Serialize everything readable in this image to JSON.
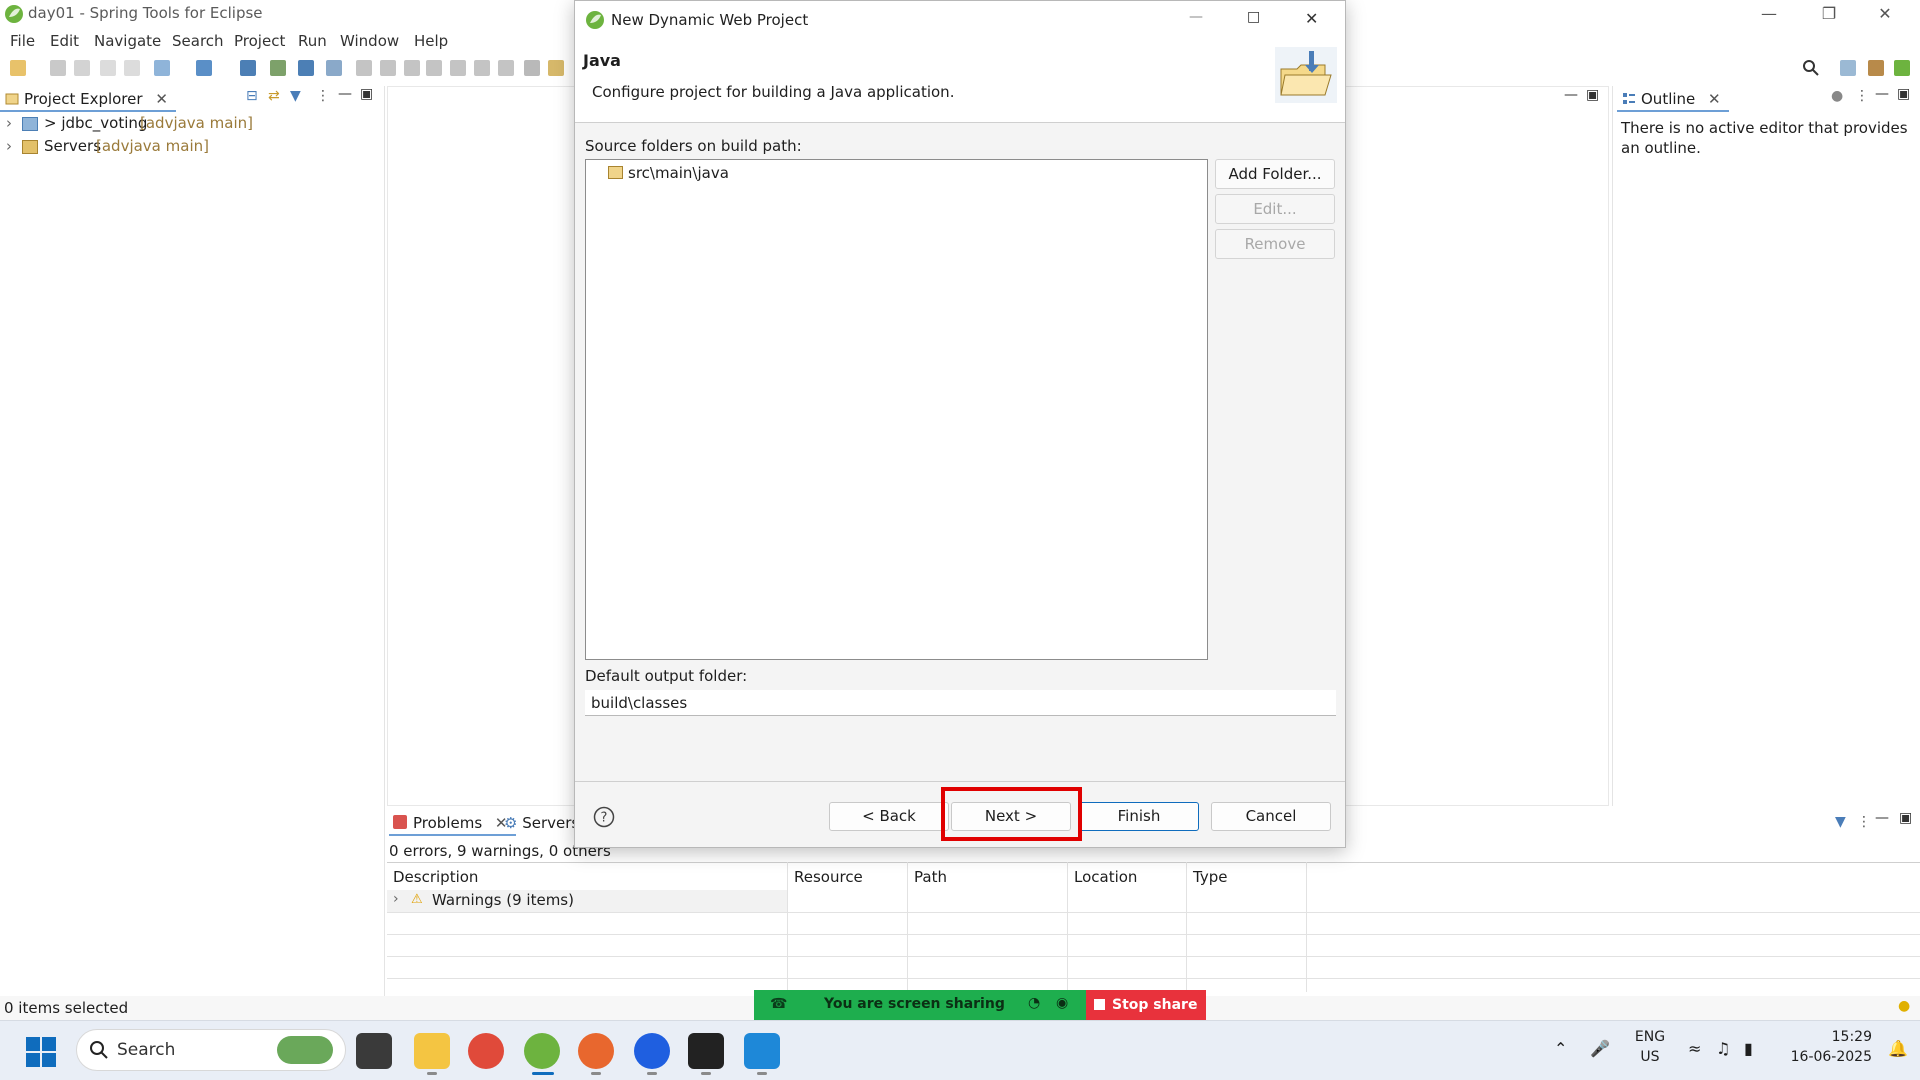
{
  "window": {
    "title": "day01 - Spring Tools for Eclipse"
  },
  "menu": [
    "File",
    "Edit",
    "Navigate",
    "Search",
    "Project",
    "Run",
    "Window",
    "Help"
  ],
  "project_explorer": {
    "tab_label": "Project Explorer",
    "items": [
      {
        "name": "> jdbc_voting",
        "repo": "[advjava main]"
      },
      {
        "name": "Servers",
        "repo": "[advjava main]"
      }
    ]
  },
  "outline": {
    "tab_label": "Outline",
    "message": "There is no active editor that provides an outline."
  },
  "problems": {
    "tabs": [
      "Problems",
      "Servers"
    ],
    "summary": "0 errors, 9 warnings, 0 others",
    "columns": [
      "Description",
      "Resource",
      "Path",
      "Location",
      "Type"
    ],
    "rows": [
      {
        "description": "Warnings (9 items)"
      }
    ]
  },
  "status": {
    "left": "0 items selected"
  },
  "dialog": {
    "title": "New Dynamic Web Project",
    "page_title": "Java",
    "page_description": "Configure project for building a Java application.",
    "source_label": "Source folders on build path:",
    "source_folders": [
      "src\\main\\java"
    ],
    "buttons": {
      "add_folder": "Add Folder...",
      "edit": "Edit...",
      "remove": "Remove",
      "back": "< Back",
      "next": "Next >",
      "finish": "Finish",
      "cancel": "Cancel"
    },
    "output_label": "Default output folder:",
    "output_value": "build\\classes"
  },
  "share": {
    "message": "You are screen sharing",
    "stop_label": "Stop share"
  },
  "taskbar": {
    "search_placeholder": "Search",
    "lang_top": "ENG",
    "lang_bottom": "US",
    "time": "15:29",
    "date": "16-06-2025"
  },
  "colors": {
    "accent": "#0f6cbd",
    "highlight": "#e00000",
    "share_green": "#1eae4e",
    "stop_red": "#e8323c"
  }
}
